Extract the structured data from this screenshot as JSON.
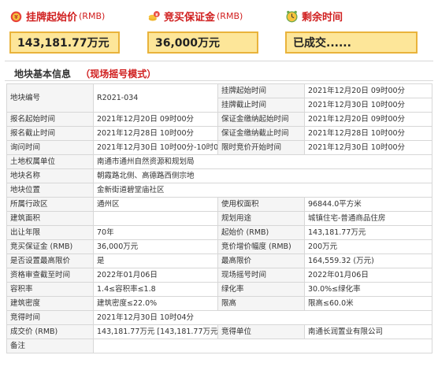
{
  "header": {
    "start_price": {
      "label": "挂牌起始价",
      "unit": "(RMB)",
      "value": "143,181.77万元"
    },
    "deposit": {
      "label": "竞买保证金",
      "unit": "(RMB)",
      "value": "36,000万元"
    },
    "remaining": {
      "label": "剩余时间",
      "value": "已成交......"
    }
  },
  "section": {
    "title": "地块基本信息",
    "mode": "（现场摇号模式）"
  },
  "icons": {
    "start_price": "money-bag-icon",
    "deposit": "coins-icon",
    "remaining": "alarm-clock-icon"
  },
  "colors": {
    "accent_red": "#d01e1e",
    "box_fill": "#fde699",
    "box_border": "#e9b33b"
  },
  "rows": {
    "r01": {
      "k2": "挂牌起始时间",
      "v2": "2021年12月20日 09时00分"
    },
    "r02": {
      "k1": "地块编号",
      "v1": "R2021-034",
      "k2": "挂牌截止时间",
      "v2": "2021年12月30日 10时00分"
    },
    "r03": {
      "k1": "报名起始时间",
      "v1": "2021年12月20日 09时00分",
      "k2": "保证金缴纳起始时间",
      "v2": "2021年12月20日 09时00分"
    },
    "r04": {
      "k1": "报名截止时间",
      "v1": "2021年12月28日 10时00分",
      "k2": "保证金缴纳截止时间",
      "v2": "2021年12月28日 10时00分"
    },
    "r05": {
      "k1": "询问时间",
      "v1": "2021年12月30日 10时00分-10时00分",
      "k2": "限时竞价开始时间",
      "v2": "2021年12月30日 10时00分"
    },
    "r06": {
      "k1": "土地权属单位",
      "v1": "南通市通州自然资源和规划局"
    },
    "r07": {
      "k1": "地块名称",
      "v1": "朝霞路北侧、高德路西侧宗地"
    },
    "r08": {
      "k1": "地块位置",
      "v1": "金新街道碧堂庙社区"
    },
    "r09": {
      "k1": "所属行政区",
      "v1": "通州区",
      "k2": "使用权面积",
      "v2": "96844.0平方米"
    },
    "r10": {
      "k1": "建筑面积",
      "v1": "",
      "k2": "规划用途",
      "v2": "城镇住宅-普通商品住房"
    },
    "r11": {
      "k1": "出让年限",
      "v1": "70年",
      "k2": "起始价 (RMB)",
      "v2": "143,181.77万元"
    },
    "r12": {
      "k1": "竞买保证金 (RMB)",
      "v1": "36,000万元",
      "k2": "竞价增价幅度 (RMB)",
      "v2": "200万元"
    },
    "r13": {
      "k1": "是否设置最高限价",
      "v1": "是",
      "k2": "最高限价",
      "v2": "164,559.32 (万元)"
    },
    "r14": {
      "k1": "资格审查截至时间",
      "v1": "2022年01月06日",
      "k2": "现场摇号时间",
      "v2": "2022年01月06日"
    },
    "r15": {
      "k1": "容积率",
      "v1": "1.4≤容积率≤1.8",
      "k2": "绿化率",
      "v2": "30.0%≤绿化率"
    },
    "r16": {
      "k1": "建筑密度",
      "v1": "建筑密度≤22.0%",
      "k2": "限高",
      "v2": "限高≤60.0米"
    },
    "r17": {
      "k1": "竞得时间",
      "v1": "2021年12月30日 10时04分"
    },
    "r18": {
      "k1": "成交价 (RMB)",
      "v1": "143,181.77万元 [143,181.77万元]",
      "k2": "竞得单位",
      "v2": "南通长润置业有限公司"
    },
    "r19": {
      "k1": "备注",
      "v1": ""
    }
  }
}
